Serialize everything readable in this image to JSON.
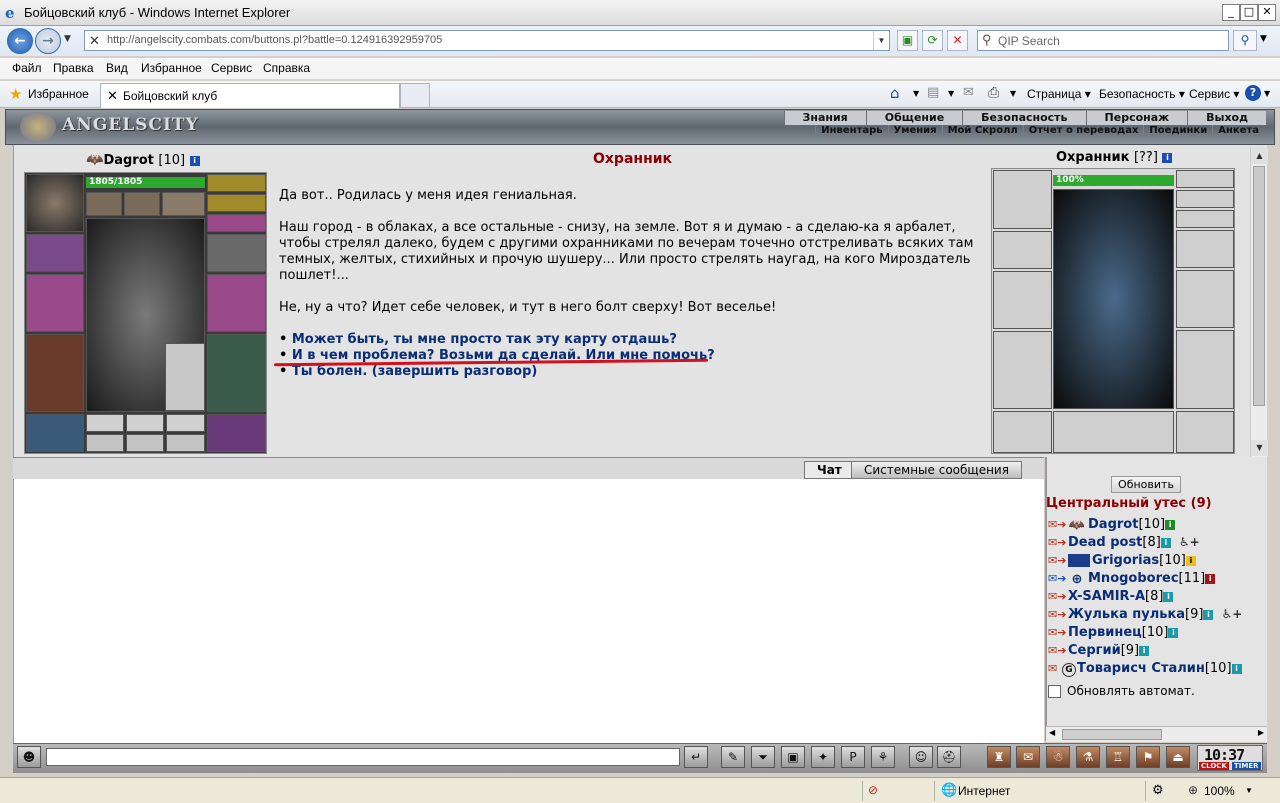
{
  "browser": {
    "window_title": "Бойцовский клуб - Windows Internet Explorer",
    "url": "http://angelscity.combats.com/buttons.pl?battle=0.124916392959705",
    "search_placeholder": "QIP Search",
    "menu": [
      "Файл",
      "Правка",
      "Вид",
      "Избранное",
      "Сервис",
      "Справка"
    ],
    "favorites_label": "Избранное",
    "tab_title": "Бойцовский клуб",
    "commands": [
      "Страница",
      "Безопасность",
      "Сервис"
    ],
    "status_zone": "Интернет",
    "zoom": "100%"
  },
  "game": {
    "logo": "ANGELSCITY",
    "top_menu": [
      "Знания",
      "Общение",
      "Безопасность",
      "Персонаж",
      "Выход"
    ],
    "sub_menu": [
      "Инвентарь",
      "Умения",
      "Мой Скролл",
      "Отчет о переводах",
      "Поединки",
      "Анкета"
    ],
    "player": {
      "name": "Dagrot",
      "level": "[10]",
      "hp": "1805/1805",
      "hp_fraction": 1.0
    },
    "npc": {
      "name": "Охранник",
      "level": "[??]",
      "hp": "100%",
      "hp_fraction": 1.0
    },
    "dialog_title": "Охранник",
    "dialog": [
      "Да вот.. Родилась у меня идея гениальная.",
      "Наш город - в облаках, а все остальные - снизу, на земле. Вот я и думаю - а сделаю-ка я арбалет, чтобы стрелял далеко, будем с другими охранниками по вечерам точечно отстреливать всяких там темных, желтых, стихийных и прочую шушеру... Или просто стрелять наугад, на кого Мироздатель пошлет!...",
      "Не, ну а что? Идет себе человек, и тут в него болт сверху! Вот веселье!"
    ],
    "choices": [
      "Может быть, ты мне просто так эту карту отдашь?",
      "И в чем проблема? Возьми да сделай. Или мне помочь?",
      "Ты болен. (завершить разговор)"
    ],
    "bullet": "•",
    "chat_tabs": [
      "Чат",
      "Системные сообщения"
    ],
    "refresh_label": "Обновить",
    "location": "Центральный утес (9)",
    "users": [
      {
        "name": "Dagrot",
        "level": "[10]",
        "info": "green"
      },
      {
        "name": "Dead post",
        "level": "[8]",
        "info": "teal"
      },
      {
        "name": "Grigorias",
        "level": "[10]",
        "info": "yellow"
      },
      {
        "name": "Mnogoborec",
        "level": "[11]",
        "info": "red"
      },
      {
        "name": "X-SAMIR-A",
        "level": "[8]",
        "info": "teal"
      },
      {
        "name": "Жулька пулька",
        "level": "[9]",
        "info": "teal"
      },
      {
        "name": "Первинец",
        "level": "[10]",
        "info": "teal"
      },
      {
        "name": "Сергий",
        "level": "[9]",
        "info": "teal"
      },
      {
        "name": "Товарисч Сталин",
        "level": "[10]",
        "info": "teal"
      }
    ],
    "guild_mark": "G",
    "auto_refresh_label": "Обновлять автомат.",
    "clock": {
      "time": "10:37",
      "label_clock": "CLOCK",
      "label_timer": "TIMER"
    }
  }
}
